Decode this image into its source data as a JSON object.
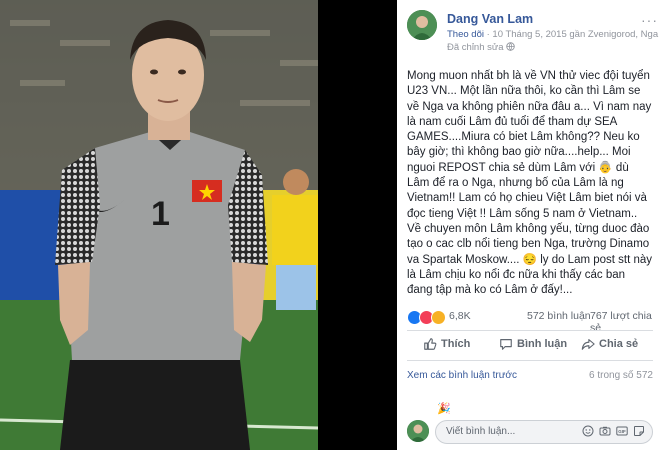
{
  "post": {
    "author": "Dang Van Lam",
    "follow": "Theo dõi",
    "meta_detail": "· 10 Tháng 5, 2015 gần Zvenigorod, Nga",
    "edited": "Đã chỉnh sửa",
    "more": "···",
    "text": "Mong muon nhất bh là về VN thử viec đội tuyển U23 VN... Một lần nữa thôi, ko cần thì Lâm se về Nga va không phiên nữa đâu a... Vì nam nay là nam cuối Lâm đủ tuổi để tham dự SEA GAMES....Miura có biet Lâm không?? Neu ko bây giờ; thì không bao giờ nữa....help... Moi nguoi REPOST chia sẻ dùm Lâm với 👵 dù Lâm để ra o Nga, nhưng bố của Lâm là ng Vietnam!! Lam có họ chieu Việt Lâm biet nói và đọc tieng Việt !! Lâm sống 5 nam ở Vietnam.. Về chuyen môn Lâm không yếu, từng duoc đào tạo o cac clb nổi tieng ben Nga, trường Dinamo va Spartak Moskow.... 😔 ly do Lam post stt này là Lâm chịu ko nổi đc nữa khi thấy các ban đang tập mà ko có Lâm ở đấy!..."
  },
  "reactions": {
    "count": "6,8K",
    "comments": "572 bình luận",
    "shares": "767 lượt chia sẻ",
    "colors": {
      "like": "#1877f2",
      "love": "#f33e58",
      "haha": "#f7b125"
    }
  },
  "actions": {
    "like": "Thích",
    "comment": "Bình luận",
    "share": "Chia sẻ"
  },
  "comments": {
    "view_previous": "Xem các bình luận trước",
    "progress": "6 trong số 572",
    "partial_emoji": "🎉",
    "placeholder": "Viết bình luận..."
  }
}
